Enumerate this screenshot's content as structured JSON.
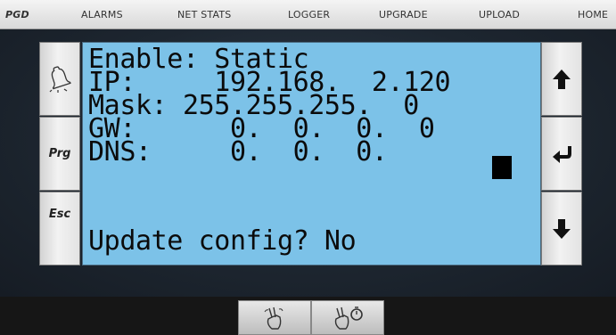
{
  "nav": {
    "brand": "PGD",
    "items": [
      "ALARMS",
      "NET STATS",
      "LOGGER",
      "UPGRADE",
      "UPLOAD",
      "HOME"
    ]
  },
  "left_buttons": {
    "prg": "Prg",
    "esc": "Esc"
  },
  "display": {
    "lines": [
      "Enable: Static",
      "IP:     192.168.  2.120",
      "Mask: 255.255.255.  0",
      "GW:      0.  0.  0.  0",
      "DNS:     0.  0.  0."
    ],
    "prompt": "Update config? No"
  },
  "icons": {
    "alarm": "bell-icon",
    "up": "arrow-up-icon",
    "enter": "enter-icon",
    "down": "arrow-down-icon",
    "gesture_left": "two-finger-swipe-icon",
    "gesture_right": "two-finger-hold-icon"
  },
  "colors": {
    "lcd_background": "#7cc2e8",
    "lcd_text": "#0b0b0b",
    "topbar": "#e6e6e6"
  }
}
